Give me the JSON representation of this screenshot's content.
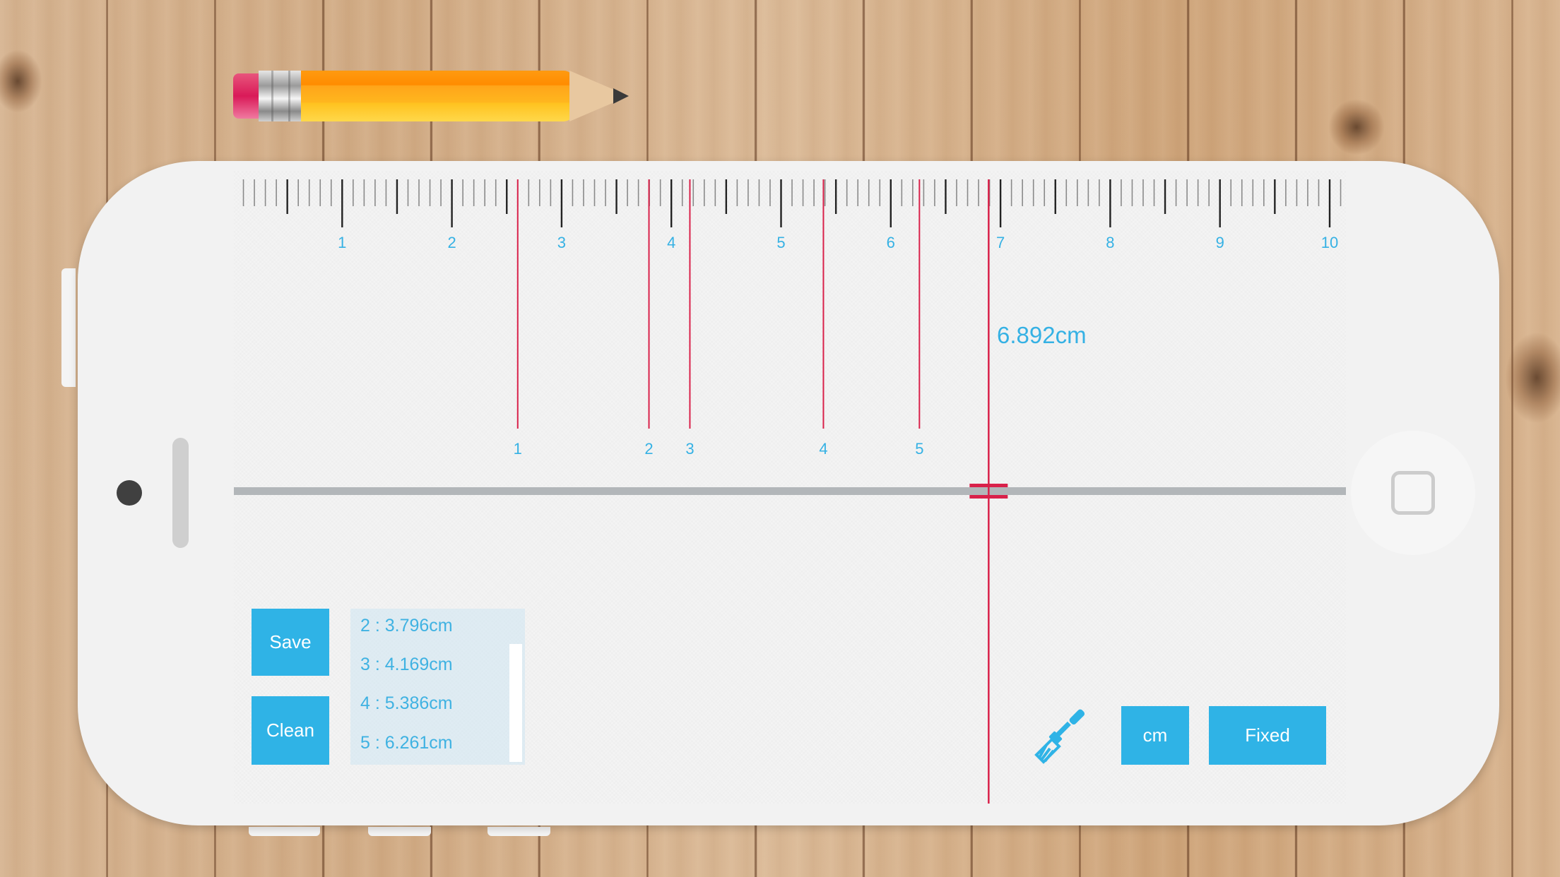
{
  "app": {
    "name": "Ruler",
    "unit": "cm",
    "accent_color": "#2fb3e6",
    "marker_color": "#d9214a"
  },
  "ruler": {
    "min": 0,
    "max": 10.1,
    "major_labels": [
      "1",
      "2",
      "3",
      "4",
      "5",
      "6",
      "7",
      "8",
      "9",
      "10"
    ],
    "minor_step": 0.1
  },
  "markers": [
    {
      "label": "1",
      "value": 2.6
    },
    {
      "label": "2",
      "value": 3.796
    },
    {
      "label": "3",
      "value": 4.169
    },
    {
      "label": "4",
      "value": 5.386
    },
    {
      "label": "5",
      "value": 6.261
    }
  ],
  "cursor": {
    "value": 6.892,
    "readout": "6.892cm"
  },
  "buttons": {
    "save": "Save",
    "clean": "Clean",
    "unit": "cm",
    "mode": "Fixed"
  },
  "saved_list": {
    "items": [
      {
        "text": "2 : 3.796cm"
      },
      {
        "text": "3 : 4.169cm"
      },
      {
        "text": "4 : 5.386cm"
      },
      {
        "text": "5 : 6.261cm"
      }
    ]
  },
  "icons": {
    "tool": "screwdriver-icon",
    "home": "home-button-icon",
    "camera": "camera-icon",
    "speaker": "speaker-icon",
    "pencil": "pencil-icon"
  }
}
